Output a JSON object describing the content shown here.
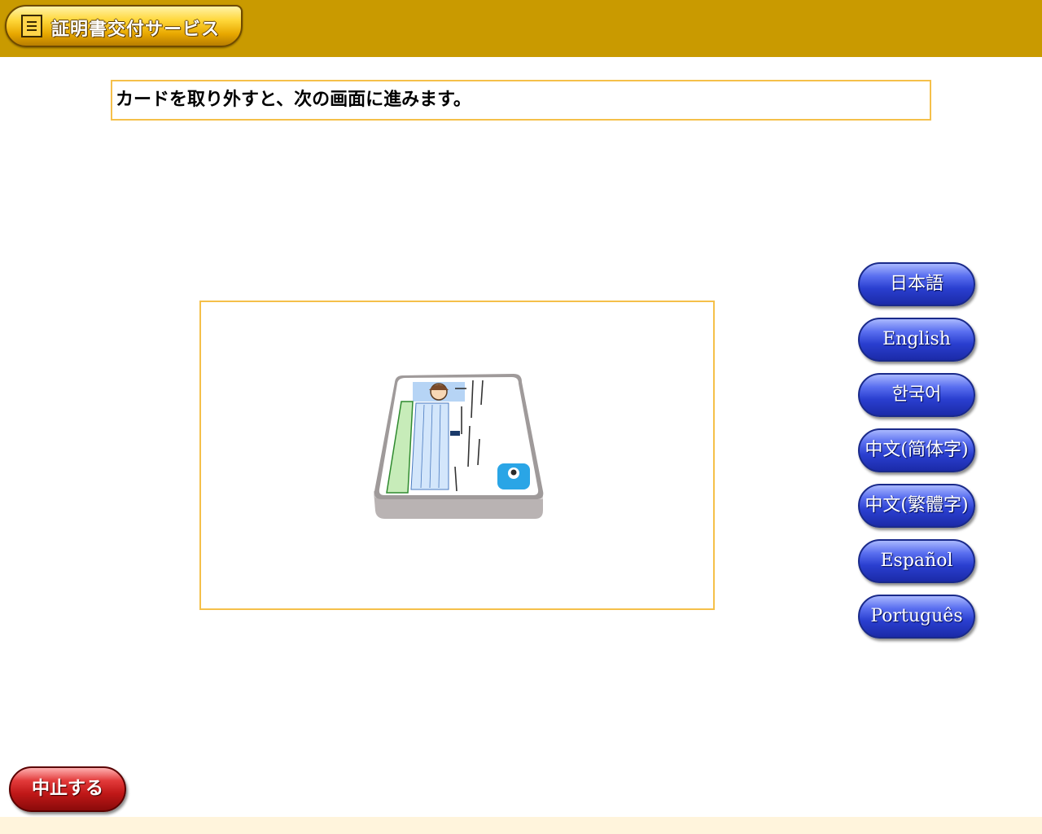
{
  "header": {
    "title": "証明書交付サービス"
  },
  "message": "カードを取り外すと、次の画面に進みます。",
  "languages": [
    {
      "label": "日本語"
    },
    {
      "label": "English"
    },
    {
      "label": "한국어"
    },
    {
      "label": "中文(简体字)"
    },
    {
      "label": "中文(繁體字)"
    },
    {
      "label": "Español"
    },
    {
      "label": "Português"
    }
  ],
  "cancel_label": "中止する",
  "colors": {
    "header_bg": "#c99a00",
    "panel_border": "#f5c04a",
    "language_button": "#2a3fd0",
    "cancel_button": "#c01818",
    "footer_bg": "#fff4dc"
  }
}
